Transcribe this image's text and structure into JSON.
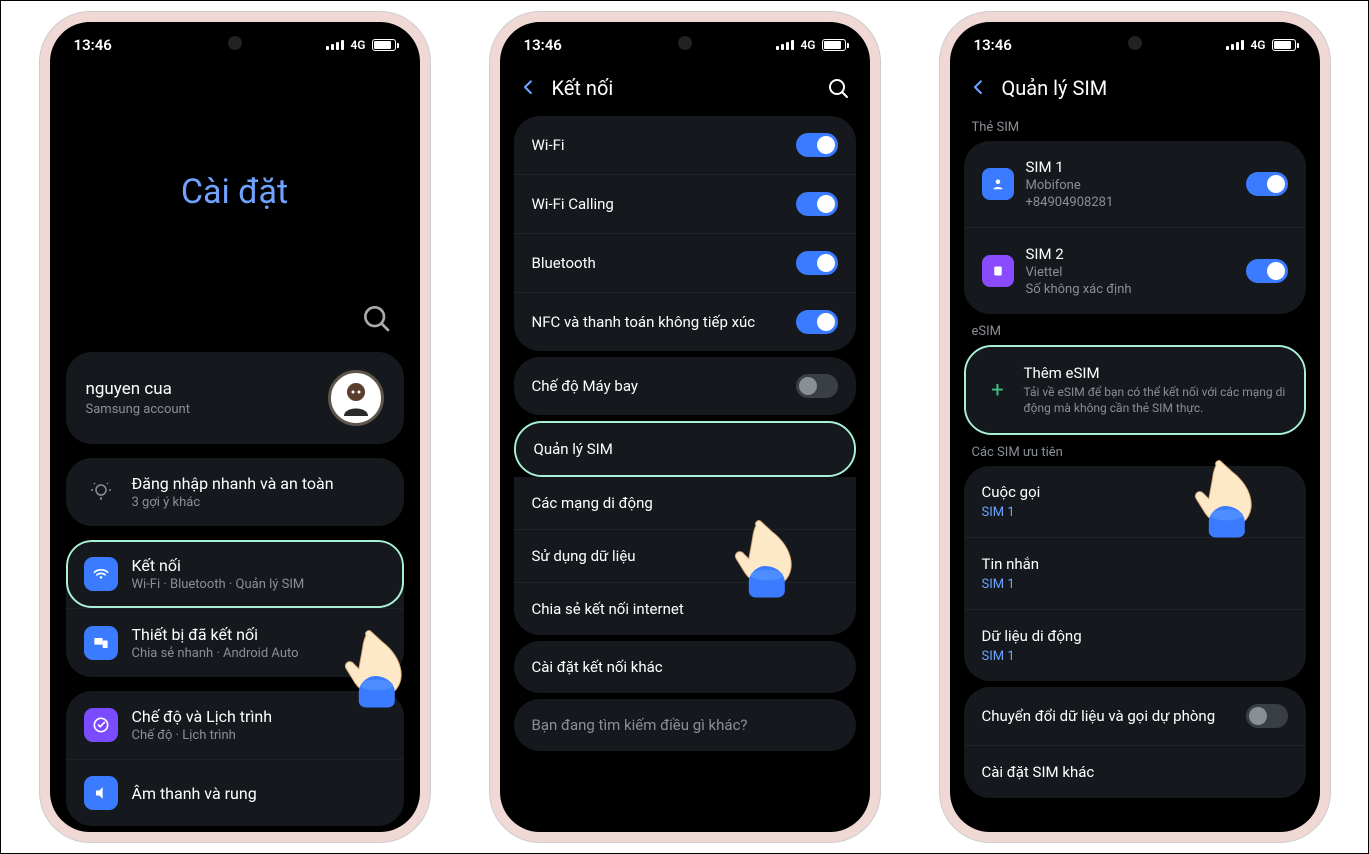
{
  "status": {
    "time": "13:46",
    "network": "4G"
  },
  "screen1": {
    "title": "Cài đặt",
    "account_name": "nguyen cua",
    "account_sub": "Samsung account",
    "quick_login": "Đăng nhập nhanh và an toàn",
    "quick_login_sub": "3 gợi ý khác",
    "connections": "Kết nối",
    "connections_sub": "Wi-Fi · Bluetooth · Quản lý SIM",
    "connected_devices": "Thiết bị đã kết nối",
    "connected_devices_sub": "Chia sẻ nhanh · Android Auto",
    "modes": "Chế độ và Lịch trình",
    "modes_sub": "Chế độ · Lịch trình",
    "sound": "Âm thanh và rung"
  },
  "screen2": {
    "title": "Kết nối",
    "wifi": "Wi-Fi",
    "wifi_calling": "Wi-Fi Calling",
    "bluetooth": "Bluetooth",
    "nfc": "NFC và thanh toán không tiếp xúc",
    "airplane": "Chế độ Máy bay",
    "sim_manager": "Quản lý SIM",
    "mobile_networks": "Các mạng di động",
    "data_usage": "Sử dụng dữ liệu",
    "tethering": "Chia sẻ kết nối internet",
    "more": "Cài đặt kết nối khác",
    "search_prompt": "Bạn đang tìm kiếm điều gì khác?"
  },
  "screen3": {
    "title": "Quản lý SIM",
    "section_sim": "Thẻ SIM",
    "sim1": "SIM 1",
    "sim1_carrier": "Mobifone",
    "sim1_number": "+84904908281",
    "sim2": "SIM 2",
    "sim2_carrier": "Viettel",
    "sim2_number": "Số không xác định",
    "section_esim": "eSIM",
    "add_esim": "Thêm eSIM",
    "add_esim_desc": "Tải về eSIM để bạn có thể kết nối với các mạng di động mà không cần thẻ SIM thực.",
    "section_preferred": "Các SIM ưu tiên",
    "calls": "Cuộc gọi",
    "messages": "Tin nhắn",
    "mobile_data": "Dữ liệu di động",
    "preferred_value": "SIM 1",
    "data_switching": "Chuyển đổi dữ liệu và gọi dự phòng",
    "other_sim": "Cài đặt SIM khác"
  }
}
